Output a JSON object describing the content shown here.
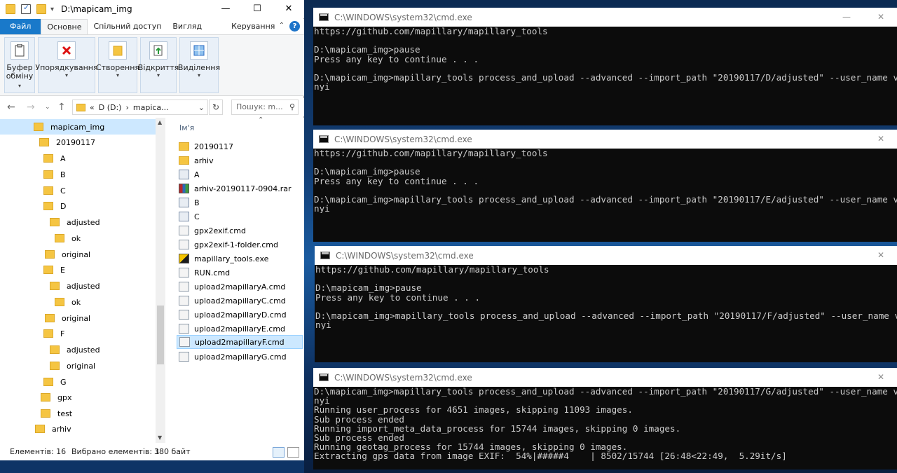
{
  "explorer": {
    "title": "D:\\mapicam_img",
    "tabs": [
      {
        "label": "Файл"
      },
      {
        "label": "Основне"
      },
      {
        "label": "Спільний доступ"
      },
      {
        "label": "Вигляд"
      },
      {
        "label": "Керування"
      }
    ],
    "ribbon_groups": [
      {
        "label_line1": "Буфер",
        "label_line2": "обміну"
      },
      {
        "label_line1": "Упорядкування",
        "label_line2": ""
      },
      {
        "label_line1": "Створення",
        "label_line2": ""
      },
      {
        "label_line1": "Відкриття",
        "label_line2": ""
      },
      {
        "label_line1": "Виділення",
        "label_line2": ""
      }
    ],
    "address": {
      "prefix": "«",
      "drive": "D (D:)",
      "sep": "›",
      "folder": "mapica..."
    },
    "search_placeholder": "Пошук: m...",
    "tree": [
      {
        "label": "mapicam_img"
      },
      {
        "label": "20190117"
      },
      {
        "label": "A"
      },
      {
        "label": "B"
      },
      {
        "label": "C"
      },
      {
        "label": "D"
      },
      {
        "label": "adjusted"
      },
      {
        "label": "ok"
      },
      {
        "label": "original"
      },
      {
        "label": "E"
      },
      {
        "label": "adjusted"
      },
      {
        "label": "ok"
      },
      {
        "label": "original"
      },
      {
        "label": "F"
      },
      {
        "label": "adjusted"
      },
      {
        "label": "original"
      },
      {
        "label": "G"
      },
      {
        "label": "gpx"
      },
      {
        "label": "test"
      },
      {
        "label": "arhiv"
      }
    ],
    "column_header": "Ім'я",
    "files": [
      {
        "name": "20190117",
        "icon": "folder-icon"
      },
      {
        "name": "arhiv",
        "icon": "folder-icon"
      },
      {
        "name": "A",
        "icon": "shortcut-icon"
      },
      {
        "name": "arhiv-20190117-0904.rar",
        "icon": "rar-archive-icon"
      },
      {
        "name": "B",
        "icon": "shortcut-icon"
      },
      {
        "name": "C",
        "icon": "shortcut-icon"
      },
      {
        "name": "gpx2exif.cmd",
        "icon": "cmd-file-icon"
      },
      {
        "name": "gpx2exif-1-folder.cmd",
        "icon": "cmd-file-icon"
      },
      {
        "name": "mapillary_tools.exe",
        "icon": "exe-icon"
      },
      {
        "name": "RUN.cmd",
        "icon": "cmd-file-icon"
      },
      {
        "name": "upload2mapillaryA.cmd",
        "icon": "cmd-file-icon"
      },
      {
        "name": "upload2mapillaryC.cmd",
        "icon": "cmd-file-icon"
      },
      {
        "name": "upload2mapillaryD.cmd",
        "icon": "cmd-file-icon"
      },
      {
        "name": "upload2mapillaryE.cmd",
        "icon": "cmd-file-icon"
      },
      {
        "name": "upload2mapillaryF.cmd",
        "icon": "cmd-file-icon",
        "selected": true
      },
      {
        "name": "upload2mapillaryG.cmd",
        "icon": "cmd-file-icon"
      }
    ],
    "status": {
      "items": "Елементів: 16",
      "selected": "Вибрано елементів: 1",
      "size": "380 байт"
    }
  },
  "cmd_windows": [
    {
      "title": "C:\\WINDOWS\\system32\\cmd.exe",
      "lines": [
        "https://github.com/mapillary/mapillary_tools",
        "",
        "D:\\mapicam_img>pause",
        "Press any key to continue . . .",
        "",
        "D:\\mapicam_img>mapillary_tools process_and_upload --advanced --import_path \"20190117/D/adjusted\" --user_name v",
        "nyi"
      ]
    },
    {
      "title": "C:\\WINDOWS\\system32\\cmd.exe",
      "lines": [
        "https://github.com/mapillary/mapillary_tools",
        "",
        "D:\\mapicam_img>pause",
        "Press any key to continue . . .",
        "",
        "D:\\mapicam_img>mapillary_tools process_and_upload --advanced --import_path \"20190117/E/adjusted\" --user_name v",
        "nyi"
      ]
    },
    {
      "title": "C:\\WINDOWS\\system32\\cmd.exe",
      "lines": [
        "https://github.com/mapillary/mapillary_tools",
        "",
        "D:\\mapicam_img>pause",
        "Press any key to continue . . .",
        "",
        "D:\\mapicam_img>mapillary_tools process_and_upload --advanced --import_path \"20190117/F/adjusted\" --user_name v",
        "nyi"
      ]
    },
    {
      "title": "C:\\WINDOWS\\system32\\cmd.exe",
      "lines": [
        "D:\\mapicam_img>mapillary_tools process_and_upload --advanced --import_path \"20190117/G/adjusted\" --user_name v",
        "nyi",
        "Running user_process for 4651 images, skipping 11093 images.",
        "Sub process ended",
        "Running import_meta_data_process for 15744 images, skipping 0 images.",
        "Sub process ended",
        "Running geotag_process for 15744 images, skipping 0 images.",
        "Extracting gps data from image EXIF:  54%|#####4    | 8502/15744 [26:48<22:49,  5.29it/s]"
      ]
    }
  ],
  "colors": {
    "accent": "#1979ca",
    "console_bg": "#0c0c0c",
    "console_fg": "#cccccc",
    "selection": "#cce8ff"
  }
}
